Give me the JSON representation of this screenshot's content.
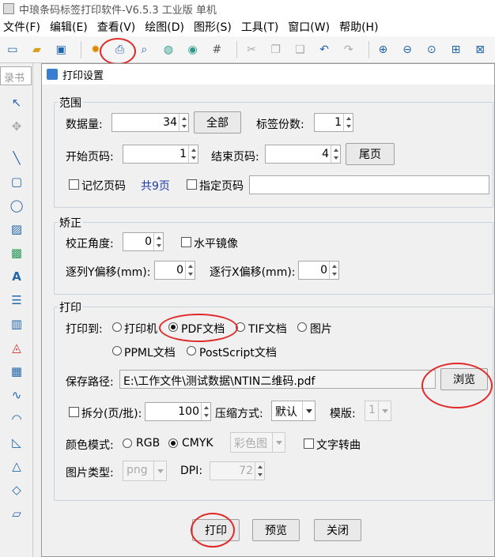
{
  "window": {
    "title": "中琅条码标签打印软件-V6.5.3 工业版 单机"
  },
  "menu": [
    "文件(F)",
    "编辑(E)",
    "查看(V)",
    "绘图(D)",
    "图形(S)",
    "工具(T)",
    "窗口(W)",
    "帮助(H)"
  ],
  "doc_tab": "录书",
  "dialog": {
    "title": "打印设置",
    "range": {
      "legend": "范围",
      "data_count_label": "数据量:",
      "data_count": "34",
      "all_button": "全部",
      "copies_label": "标签份数:",
      "copies": "1",
      "start_page_label": "开始页码:",
      "start_page": "1",
      "end_page_label": "结束页码:",
      "end_page": "4",
      "last_page_button": "尾页",
      "remember_label": "记忆页码",
      "total_pages": "共9页",
      "specify_label": "指定页码",
      "specify_value": ""
    },
    "correction": {
      "legend": "矫正",
      "angle_label": "校正角度:",
      "angle": "0",
      "mirror_label": "水平镜像",
      "y_offset_label": "逐列Y偏移(mm):",
      "y_offset": "0",
      "x_offset_label": "逐行X偏移(mm):",
      "x_offset": "0"
    },
    "print": {
      "legend": "打印",
      "print_to_label": "打印到:",
      "options": [
        "打印机",
        "PDF文档",
        "TIF文档",
        "图片",
        "PPML文档",
        "PostScript文档"
      ],
      "selected": "PDF文档",
      "save_path_label": "保存路径:",
      "save_path": "E:\\工作文件\\测试数据\\NTIN二维码.pdf",
      "browse_button": "浏览",
      "split_label": "拆分(页/批):",
      "split_value": "100",
      "compress_label": "压缩方式:",
      "compress_value": "默认",
      "template_label": "模版:",
      "template_value": "1",
      "color_mode_label": "颜色模式:",
      "color_modes": [
        "RGB",
        "CMYK"
      ],
      "color_mode_selected": "CMYK",
      "color_image_value": "彩色图",
      "text_curve_label": "文字转曲",
      "image_type_label": "图片类型:",
      "image_type_value": "png",
      "dpi_label": "DPI:",
      "dpi_value": "72"
    },
    "buttons": {
      "print": "打印",
      "preview": "预览",
      "close": "关闭"
    }
  },
  "colors": {
    "highlight_circle": "#e02a2a",
    "group_border": "#c8d4e0"
  }
}
